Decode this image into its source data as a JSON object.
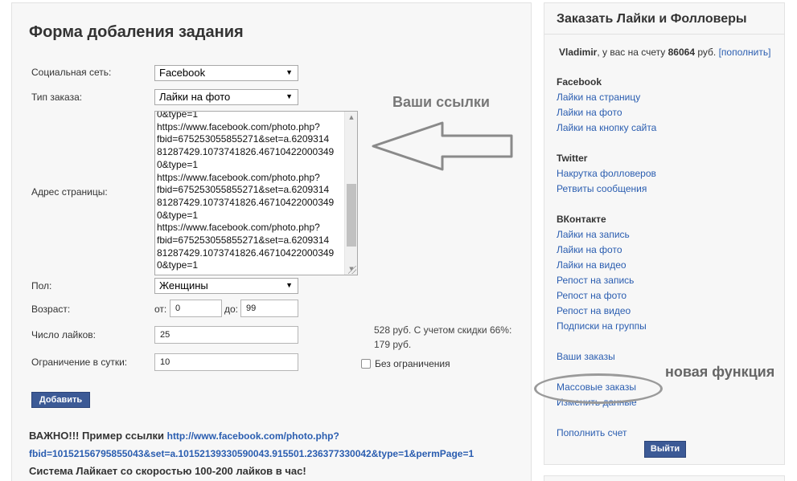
{
  "form": {
    "title": "Форма добаления задания",
    "social_network": {
      "label": "Социальная сеть:",
      "value": "Facebook"
    },
    "order_type": {
      "label": "Тип заказа:",
      "value": "Лайки на фото"
    },
    "page_address": {
      "label": "Адрес страницы:",
      "value": "0&type=1\nhttps://www.facebook.com/photo.php?\nfbid=675253055855271&set=a.6209314\n81287429.1073741826.46710422000349\n0&type=1\nhttps://www.facebook.com/photo.php?\nfbid=675253055855271&set=a.6209314\n81287429.1073741826.46710422000349\n0&type=1\nhttps://www.facebook.com/photo.php?\nfbid=675253055855271&set=a.6209314\n81287429.1073741826.46710422000349\n0&type=1"
    },
    "gender": {
      "label": "Пол:",
      "value": "Женщины"
    },
    "age": {
      "label": "Возраст:",
      "from_label": "от:",
      "from_value": "0",
      "to_label": "до:",
      "to_value": "99"
    },
    "likes_count": {
      "label": "Число лайков:",
      "value": "25"
    },
    "daily_limit": {
      "label": "Ограничение в сутки:",
      "value": "10"
    },
    "price_line1": "528 руб. С учетом скидки 66%:",
    "price_line2": "179 руб.",
    "no_limit_label": "Без ограничения",
    "add_button": "Добавить",
    "important_prefix": "ВАЖНО!!! Пример ссылки",
    "example_link_1": "http://www.facebook.com/photo.php?",
    "example_link_2": "fbid=10152156795855043&set=a.10152139330590043.915501.236377330042&type=1&permPage=1",
    "speed_note": "Система Лайкает со скоростью 100-200 лайков в час!"
  },
  "annotations": {
    "your_links": "Ваши ссылки",
    "new_feature": "новая функция"
  },
  "sidebar": {
    "title": "Заказать Лайки и Фолловеры",
    "user": "Vladimir",
    "balance_text": ", у вас на счету",
    "balance": "86064",
    "currency": "руб.",
    "topup_link": "[пополнить]",
    "sections": [
      {
        "title": "Facebook",
        "items": [
          "Лайки на страницу",
          "Лайки на фото",
          "Лайки на кнопку сайта"
        ]
      },
      {
        "title": "Twitter",
        "items": [
          "Накрутка фолловеров",
          "Ретвиты сообщения"
        ]
      },
      {
        "title": "ВКонтакте",
        "items": [
          "Лайки на запись",
          "Лайки на фото",
          "Лайки на видео",
          "Репост на запись",
          "Репост на фото",
          "Репост на видео",
          "Подписки на группы"
        ]
      }
    ],
    "your_orders": "Ваши заказы",
    "mass_orders": "Массовые заказы",
    "change_data": "Изменить данные",
    "topup_account": "Пополнить счет",
    "exit_button": "Выйти"
  },
  "colors": {
    "link": "#2a5db0",
    "button": "#3c5a96",
    "panel": "#f7f7f7"
  }
}
